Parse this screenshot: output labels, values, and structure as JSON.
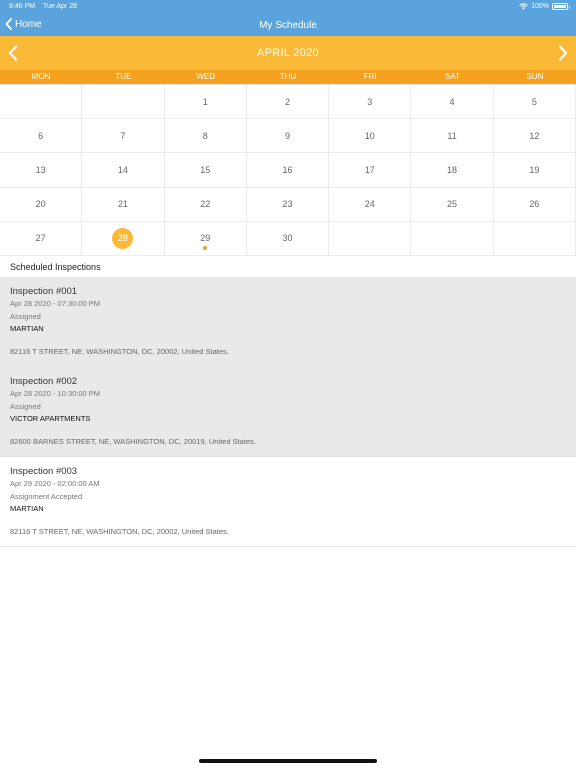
{
  "status_bar": {
    "time": "9:46 PM",
    "date": "Tue Apr 28",
    "battery": "100%",
    "battery_level": 1.0
  },
  "nav": {
    "back_label": "Home",
    "title": "My Schedule"
  },
  "calendar": {
    "month_title": "APRIL 2020",
    "weekdays": [
      "MON",
      "TUE",
      "WED",
      "THU",
      "FRI",
      "SAT",
      "SUN"
    ],
    "weeks": [
      [
        "",
        "",
        "1",
        "2",
        "3",
        "4",
        "5"
      ],
      [
        "6",
        "7",
        "8",
        "9",
        "10",
        "11",
        "12"
      ],
      [
        "13",
        "14",
        "15",
        "16",
        "17",
        "18",
        "19"
      ],
      [
        "20",
        "21",
        "22",
        "23",
        "24",
        "25",
        "26"
      ],
      [
        "27",
        "28",
        "29",
        "30",
        "",
        "",
        ""
      ]
    ],
    "selected_day": "28",
    "event_days": [
      "29"
    ]
  },
  "section_title": "Scheduled Inspections",
  "inspections": [
    {
      "title": "Inspection #001",
      "time": "Apr 28 2020 - 07:30:00 PM",
      "status": "Assigned",
      "owner": "MARTIAN",
      "address": "82116 T STREET, NE, WASHINGTON, DC, 20002, United States."
    },
    {
      "title": "Inspection #002",
      "time": "Apr 28 2020 - 10:30:00 PM",
      "status": "Assigned",
      "owner": "VICTOR APARTMENTS",
      "address": "82600 BARNES STREET, NE, WASHINGTON, DC, 20019, United States."
    },
    {
      "title": "Inspection #003",
      "time": "Apr 29 2020 - 02:00:00 AM",
      "status": "Assignment Accepted",
      "owner": "MARTIAN",
      "address": "82116 T STREET, NE, WASHINGTON, DC, 20002, United States."
    }
  ],
  "icons": {
    "back": "chevron-left-icon",
    "prev": "chevron-left-icon",
    "next": "chevron-right-icon",
    "wifi": "wifi-icon",
    "battery": "battery-icon"
  },
  "colors": {
    "nav_blue": "#5aa3dc",
    "accent_orange": "#fbb938",
    "weekday_orange": "#f4a11f",
    "row_shade": "#e9e9e9"
  }
}
